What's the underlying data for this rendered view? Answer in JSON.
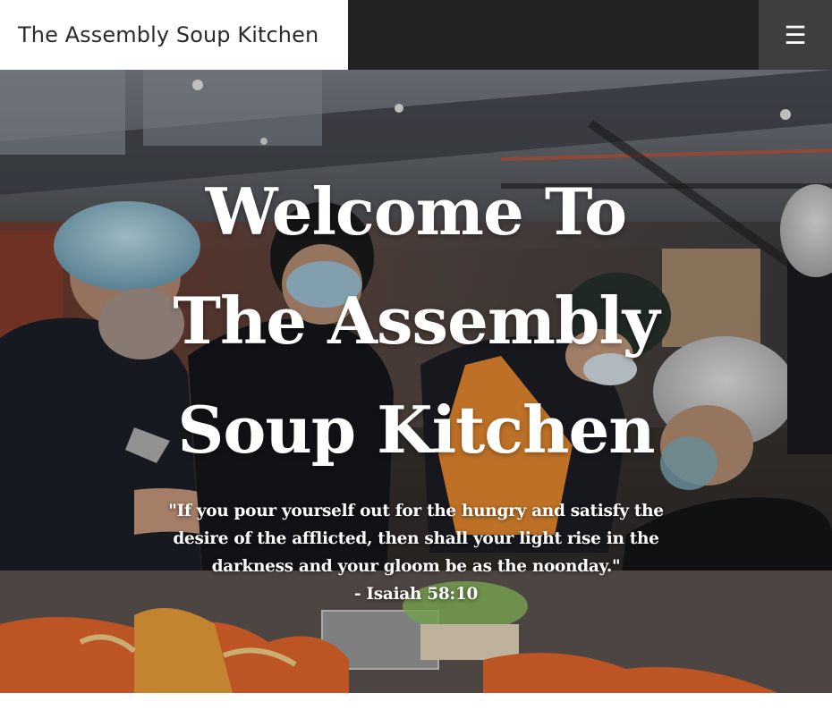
{
  "header": {
    "site_title": "The Assembly Soup Kitchen",
    "menu_icon": "hamburger-menu-icon",
    "menu_glyph": "☰"
  },
  "hero": {
    "headline_lines": [
      "Welcome To",
      "The Assembly",
      "Soup Kitchen"
    ],
    "quote": "\"If you pour yourself out for the hungry and satisfy the desire of the afflicted, then shall your light rise in the darkness and your gloom be as the noonday.\"",
    "citation": "- Isaiah 58:10"
  },
  "colors": {
    "header_dark": "#232222",
    "menu_button": "#3f3e3e",
    "brand_bg": "#ffffff",
    "hero_text": "#ffffff"
  }
}
